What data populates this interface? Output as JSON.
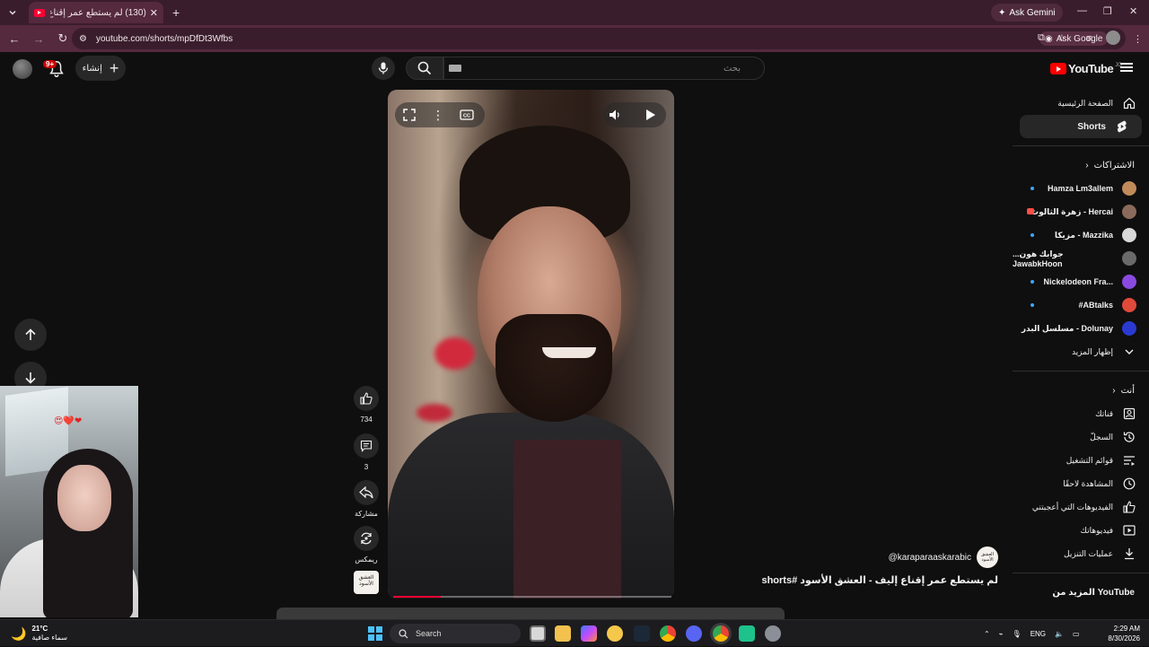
{
  "browser": {
    "tab_title": "(130) لم يستطع عمر إقناع إليف - ...",
    "ask_gemini": "Ask Gemini",
    "url": "youtube.com/shorts/mpDfDt3Wfbs",
    "ask_google": "Ask Google"
  },
  "header": {
    "create_label": "إنشاء",
    "notification_count": "9+",
    "search_placeholder": "بحث",
    "logo_text": "YouTube",
    "logo_country": "JO"
  },
  "short": {
    "likes": "734",
    "comments": "3",
    "share_label": "مشاركة",
    "remix_label": "ريمكس",
    "channel_handle": "@karaparaaskarabic",
    "channel_logo_text": "العشق الأسود",
    "title": "لم يستطع عمر إقناع إليف - العشق الأسود #shorts",
    "progress": 0.17
  },
  "sidebar": {
    "main": [
      {
        "label": "الصفحة الرئيسية",
        "icon": "home-icon"
      },
      {
        "label": "Shorts",
        "icon": "shorts-icon",
        "active": true
      }
    ],
    "subscriptions_header": "الاشتراكات",
    "subscriptions": [
      {
        "label": "Hamza Lm3allem",
        "dot": true,
        "color": "#c08a5a"
      },
      {
        "label": "زهرة الثالوث - Hercai",
        "live": true,
        "color": "#8a6a5a"
      },
      {
        "label": "مزيكا - Mazzika",
        "dot": true,
        "color": "#d8d8d8"
      },
      {
        "label": "...جوابك هون JawabkHoon",
        "color": "#6a6a6a"
      },
      {
        "label": "Nickelodeon Fra...",
        "dot": true,
        "color": "#8a4ae0"
      },
      {
        "label": "#ABtalks",
        "dot": true,
        "color": "#e04a3a"
      },
      {
        "label": "مسلسل البدر - Dolunay",
        "color": "#2a3ad0"
      }
    ],
    "show_more": "إظهار المزيد",
    "you_header": "أنت",
    "you_items": [
      {
        "label": "قناتك",
        "icon": "channel-icon"
      },
      {
        "label": "السجلّ",
        "icon": "history-icon"
      },
      {
        "label": "قوائم التشغيل",
        "icon": "playlists-icon"
      },
      {
        "label": "المشاهدة لاحقًا",
        "icon": "watch-later-icon"
      },
      {
        "label": "الفيديوهات التي أعجبتني",
        "icon": "liked-icon"
      },
      {
        "label": "فيديوهاتك",
        "icon": "your-videos-icon"
      },
      {
        "label": "عمليات التنزيل",
        "icon": "download-icon"
      }
    ],
    "more_from": "المزيد من YouTube"
  },
  "taskbar": {
    "temperature": "21°C",
    "weather_desc": "سماء صافية",
    "search_label": "Search",
    "language": "ENG",
    "time": "2:29 AM",
    "date": "8/30/2026"
  },
  "colors": {
    "accent": "#ff0033",
    "browser_frame": "#3a1d2c",
    "browser_toolbar": "#55293e"
  }
}
